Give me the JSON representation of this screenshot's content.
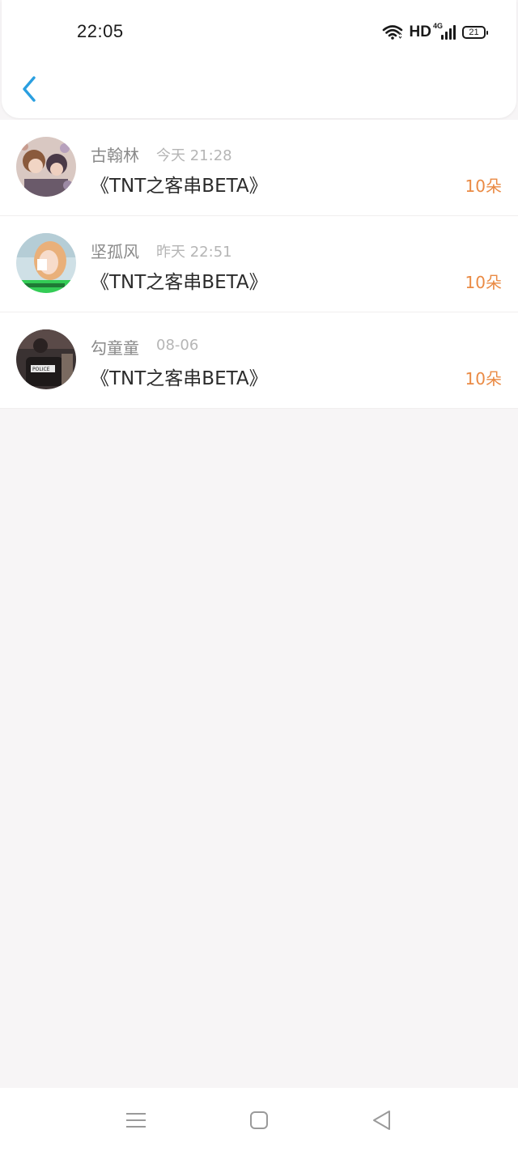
{
  "status_bar": {
    "time": "22:05",
    "hd": "HD",
    "network": "4G",
    "battery": "21"
  },
  "header": {
    "back_icon": "chevron-left-icon"
  },
  "colors": {
    "accent": "#2a9fe0",
    "amount": "#ea8a44",
    "name": "#8a8a8a",
    "time": "#b5b5b5",
    "title": "#2b2b2b",
    "background": "#f7f5f6"
  },
  "records": [
    {
      "name": "古翰林",
      "time": "今天 21:28",
      "title": "《TNT之客串BETA》",
      "amount": "10朵"
    },
    {
      "name": "坚孤风",
      "time": "昨天 22:51",
      "title": "《TNT之客串BETA》",
      "amount": "10朵"
    },
    {
      "name": "勾童童",
      "time": "08-06",
      "title": "《TNT之客串BETA》",
      "amount": "10朵"
    }
  ],
  "avatar_badges": {
    "police": "POLICE"
  },
  "navbar": {
    "menu_icon": "menu-icon",
    "home_icon": "home-square-icon",
    "back_icon": "back-triangle-icon"
  }
}
